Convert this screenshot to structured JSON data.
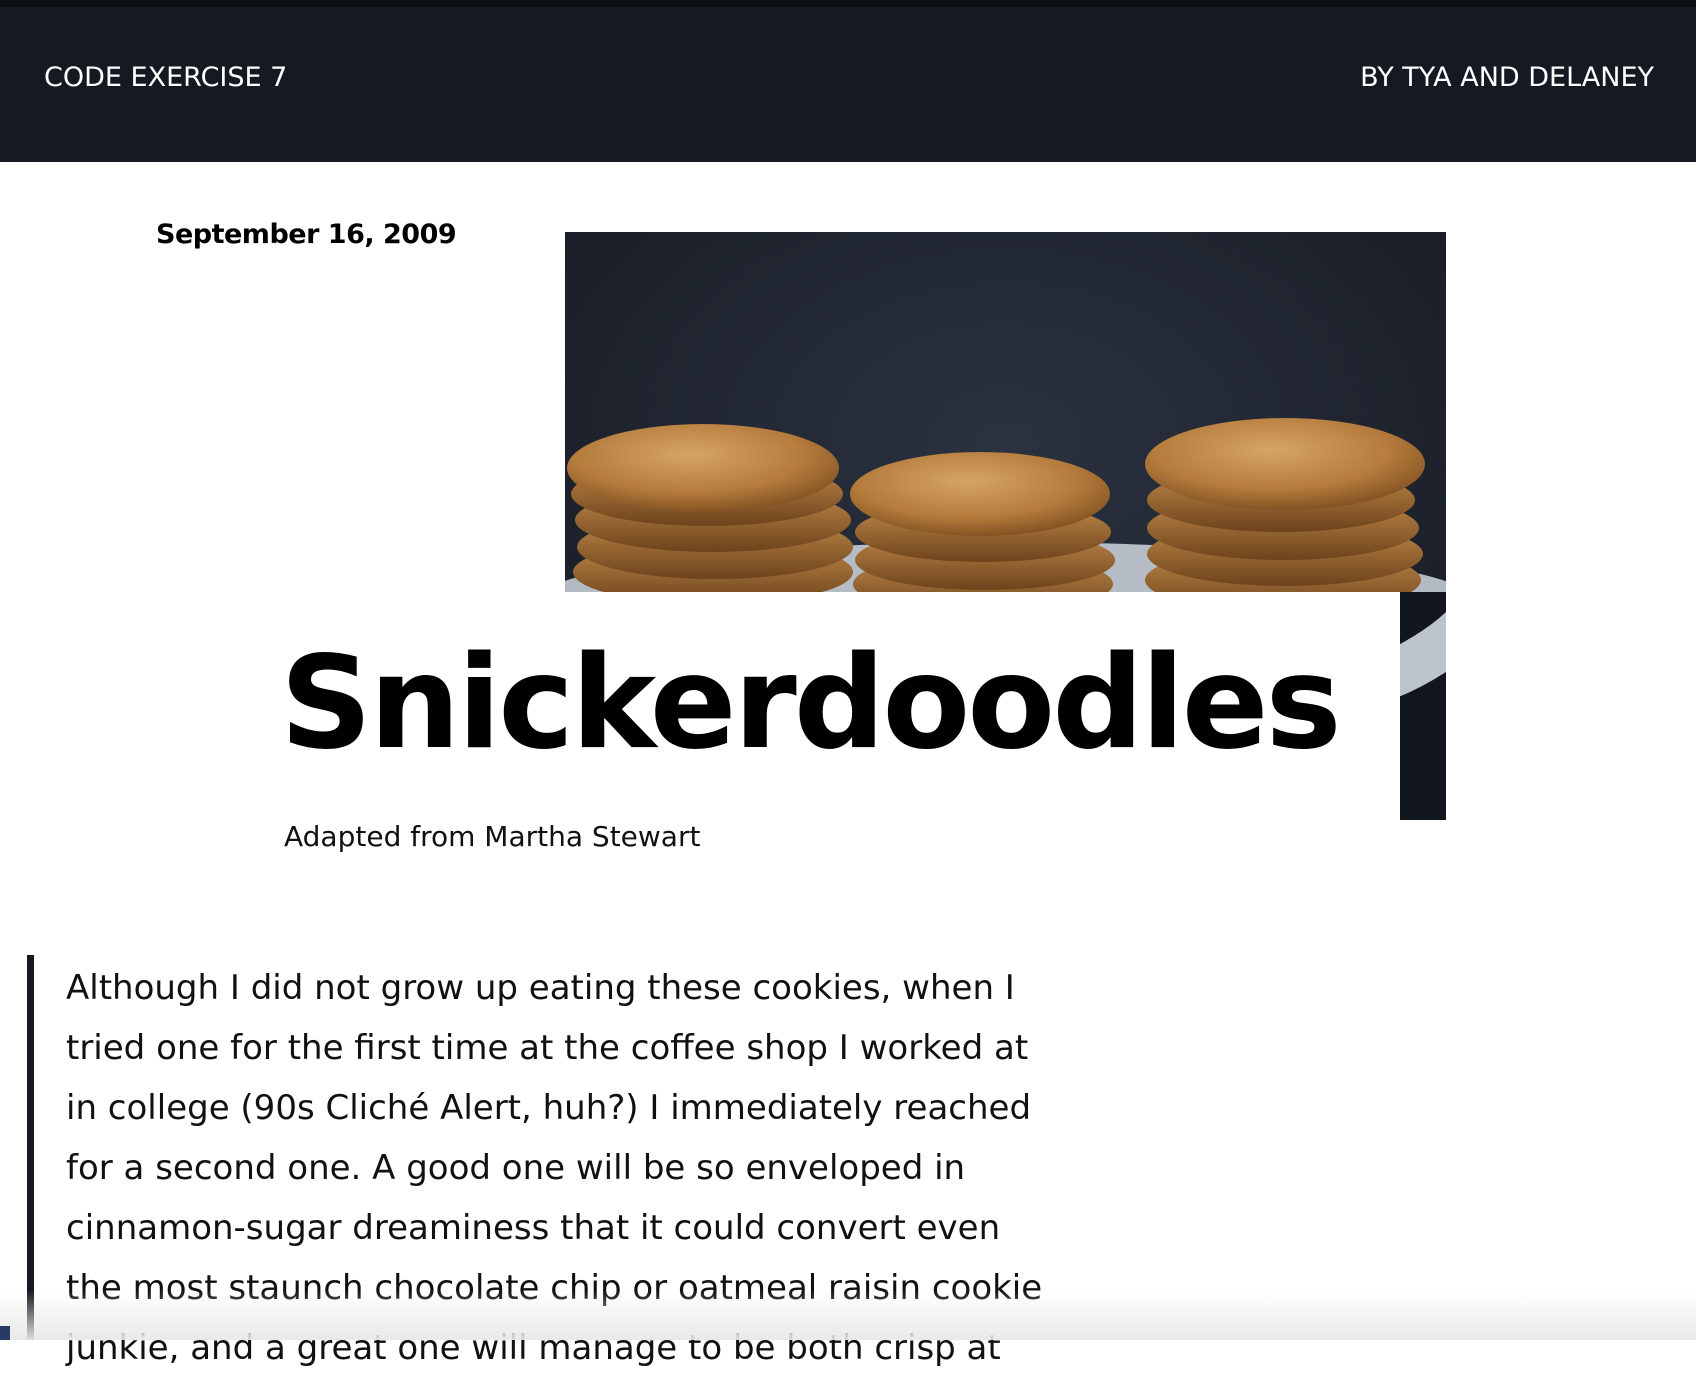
{
  "header": {
    "site_title": "CODE EXERCISE 7",
    "byline": "BY TYA AND DELANEY"
  },
  "post": {
    "date": "September 16, 2009",
    "title": "Snickerdoodles",
    "subtitle": "Adapted from Martha Stewart",
    "hero_image": "snickerdoodle-cookie-stacks-photo",
    "intro": "Although I did not grow up eating these cookies, when I tried one for the first time at the coffee shop I worked at in college (90s Cliché Alert, huh?) I immediately reached for a second one. A good one will be so enveloped in cinnamon-sugar dreaminess that it could convert even the most staunch chocolate chip or oatmeal raisin cookie junkie, and a great one will manage to be both crisp at"
  },
  "colors": {
    "header_bg": "#151a22",
    "text": "#111111",
    "accent_bar": "#151a22"
  }
}
